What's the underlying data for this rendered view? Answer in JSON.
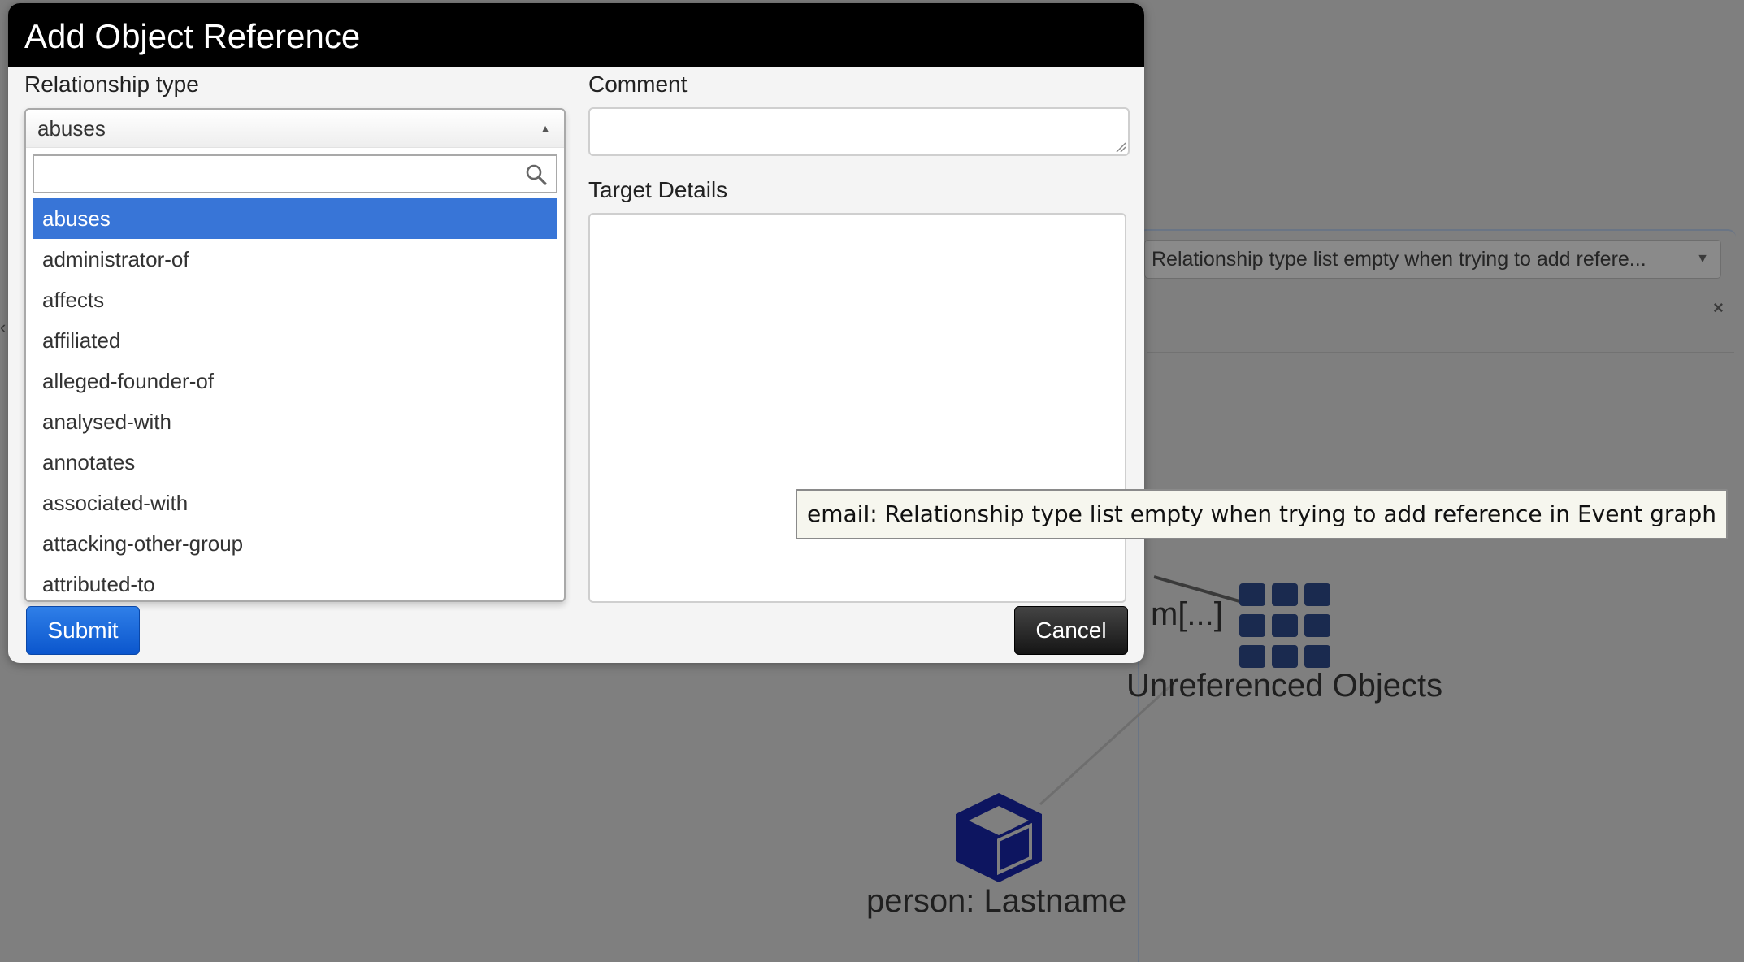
{
  "modal": {
    "title": "Add Object Reference",
    "relationship_label": "Relationship type",
    "comment_label": "Comment",
    "target_label": "Target Details",
    "relationship_selected": "abuses",
    "search_value": "",
    "options": [
      "abuses",
      "administrator-of",
      "affects",
      "affiliated",
      "alleged-founder-of",
      "analysed-with",
      "annotates",
      "associated-with",
      "attacking-other-group",
      "attributed-to"
    ],
    "submit_label": "Submit",
    "cancel_label": "Cancel"
  },
  "background": {
    "select_value": "Relationship type list empty when trying to add refere...",
    "node_partial": "m[...]",
    "node_unreferenced": "Unreferenced Objects",
    "node_person": "person: Lastname"
  },
  "tooltip": {
    "text": "email: Relationship type list empty when trying to add reference in Event graph"
  },
  "colors": {
    "selected_option": "#3875d7",
    "submit_button": "#0b56cd",
    "cancel_button": "#151515",
    "node_icon": "#1a2a4f"
  }
}
